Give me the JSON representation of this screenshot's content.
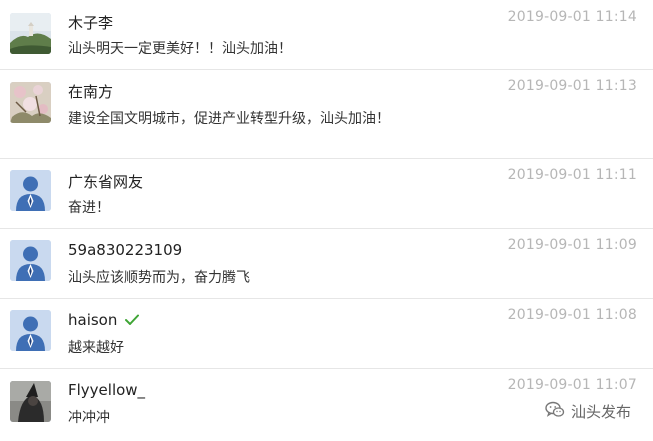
{
  "comments": [
    {
      "name": "木子李",
      "time": "2019-09-01 11:14",
      "text": "汕头明天一定更美好！！汕头加油！",
      "avatar": "hill-photo"
    },
    {
      "name": "在南方",
      "time": "2019-09-01 11:13",
      "text": "建设全国文明城市，促进产业转型升级，汕头加油！",
      "avatar": "flower-photo"
    },
    {
      "name": "广东省网友",
      "time": "2019-09-01 11:11",
      "text": "奋进！",
      "avatar": "default-user"
    },
    {
      "name": "59a830223109",
      "time": "2019-09-01 11:09",
      "text": "汕头应该顺势而为，奋力腾飞",
      "avatar": "default-user"
    },
    {
      "name": "haison",
      "time": "2019-09-01 11:08",
      "text": "越来越好",
      "avatar": "default-user",
      "verified": true
    },
    {
      "name": "Flyyellow_",
      "time": "2019-09-01 11:07",
      "text": "冲冲冲",
      "avatar": "dark-photo"
    }
  ],
  "watermark": {
    "text": "汕头发布",
    "icon": "wechat-icon"
  },
  "colors": {
    "verified_check": "#3fa535",
    "timestamp": "#b6b6b6",
    "avatar_default_bg": "#c9d9ef"
  }
}
